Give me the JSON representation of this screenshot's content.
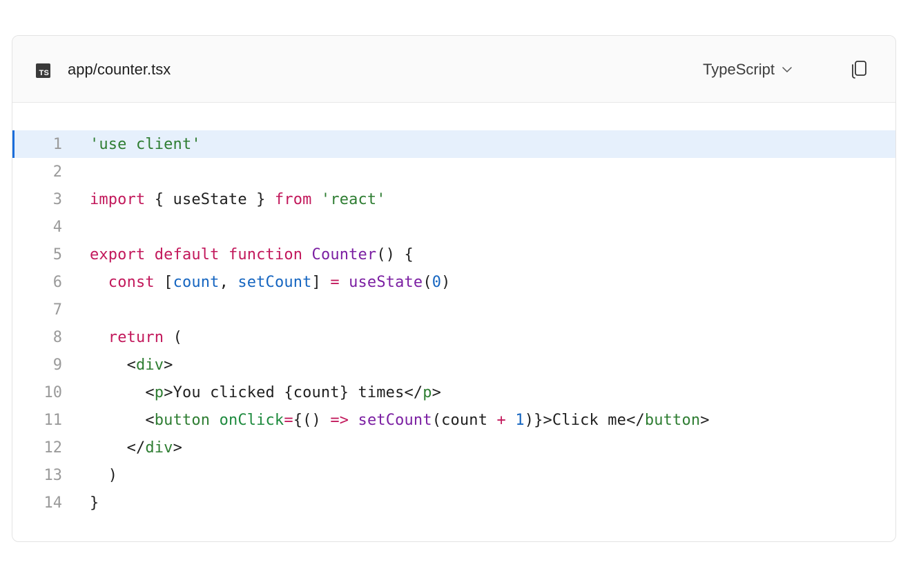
{
  "file": {
    "badge": "TS",
    "name": "app/counter.tsx",
    "language": "TypeScript"
  },
  "icons": {
    "badge": "typescript-file-icon",
    "chevron": "chevron-down-icon",
    "copy": "copy-icon"
  },
  "colors": {
    "keyword": "#c2185b",
    "string": "#2e7d32",
    "function": "#7b1fa2",
    "variable": "#1565c0",
    "highlight_bg": "#e6f0fc",
    "highlight_bar": "#1a6ddb"
  },
  "highlighted_line": 1,
  "code_lines": [
    {
      "n": "1",
      "tokens": [
        [
          "str",
          "'use client'"
        ]
      ]
    },
    {
      "n": "2",
      "tokens": []
    },
    {
      "n": "3",
      "tokens": [
        [
          "kw",
          "import"
        ],
        [
          "pl",
          " { useState } "
        ],
        [
          "kw",
          "from"
        ],
        [
          "pl",
          " "
        ],
        [
          "str",
          "'react'"
        ]
      ]
    },
    {
      "n": "4",
      "tokens": []
    },
    {
      "n": "5",
      "tokens": [
        [
          "kw",
          "export"
        ],
        [
          "pl",
          " "
        ],
        [
          "kw",
          "default"
        ],
        [
          "pl",
          " "
        ],
        [
          "kw",
          "function"
        ],
        [
          "pl",
          " "
        ],
        [
          "fn",
          "Counter"
        ],
        [
          "pl",
          "() {"
        ]
      ]
    },
    {
      "n": "6",
      "tokens": [
        [
          "pl",
          "  "
        ],
        [
          "kw",
          "const"
        ],
        [
          "pl",
          " ["
        ],
        [
          "var",
          "count"
        ],
        [
          "pl",
          ", "
        ],
        [
          "var",
          "setCount"
        ],
        [
          "pl",
          "] "
        ],
        [
          "op",
          "="
        ],
        [
          "pl",
          " "
        ],
        [
          "fn",
          "useState"
        ],
        [
          "pl",
          "("
        ],
        [
          "num",
          "0"
        ],
        [
          "pl",
          ")"
        ]
      ]
    },
    {
      "n": "7",
      "tokens": []
    },
    {
      "n": "8",
      "tokens": [
        [
          "pl",
          "  "
        ],
        [
          "kw",
          "return"
        ],
        [
          "pl",
          " ("
        ]
      ]
    },
    {
      "n": "9",
      "tokens": [
        [
          "pl",
          "    <"
        ],
        [
          "tag",
          "div"
        ],
        [
          "pl",
          ">"
        ]
      ]
    },
    {
      "n": "10",
      "tokens": [
        [
          "pl",
          "      <"
        ],
        [
          "tag",
          "p"
        ],
        [
          "pl",
          ">You clicked {count} times</"
        ],
        [
          "tag",
          "p"
        ],
        [
          "pl",
          ">"
        ]
      ]
    },
    {
      "n": "11",
      "tokens": [
        [
          "pl",
          "      <"
        ],
        [
          "tag",
          "button"
        ],
        [
          "pl",
          " "
        ],
        [
          "attr",
          "onClick"
        ],
        [
          "op",
          "="
        ],
        [
          "pl",
          "{() "
        ],
        [
          "op",
          "=>"
        ],
        [
          "pl",
          " "
        ],
        [
          "fn",
          "setCount"
        ],
        [
          "pl",
          "(count "
        ],
        [
          "op",
          "+"
        ],
        [
          "pl",
          " "
        ],
        [
          "num",
          "1"
        ],
        [
          "pl",
          ")}>Click me</"
        ],
        [
          "tag",
          "button"
        ],
        [
          "pl",
          ">"
        ]
      ]
    },
    {
      "n": "12",
      "tokens": [
        [
          "pl",
          "    </"
        ],
        [
          "tag",
          "div"
        ],
        [
          "pl",
          ">"
        ]
      ]
    },
    {
      "n": "13",
      "tokens": [
        [
          "pl",
          "  )"
        ]
      ]
    },
    {
      "n": "14",
      "tokens": [
        [
          "pl",
          "}"
        ]
      ]
    }
  ]
}
